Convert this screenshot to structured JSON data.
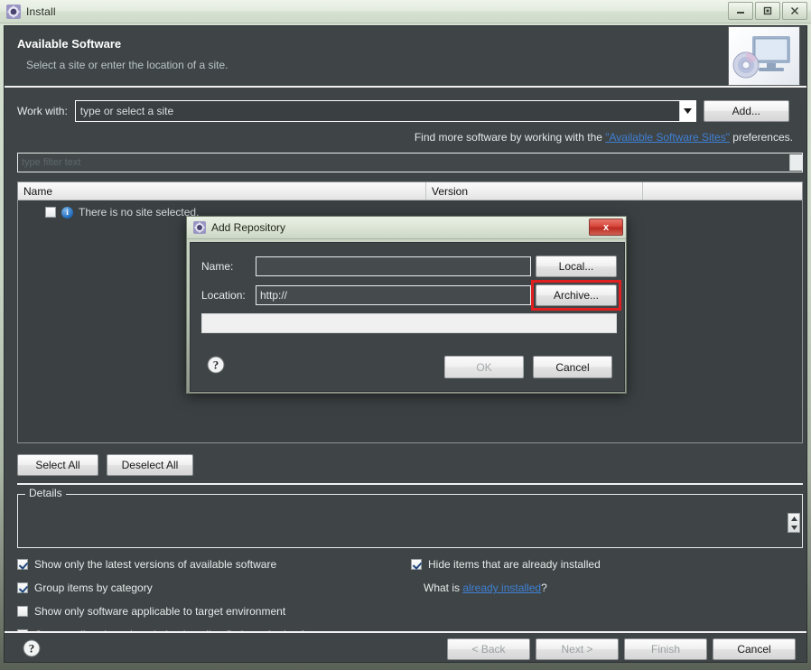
{
  "window": {
    "title": "Install",
    "icon": "eclipse-gear-icon",
    "controls": {
      "minimize": "minimize-icon",
      "maximize": "maximize-icon",
      "close": "close-icon"
    }
  },
  "header": {
    "title": "Available Software",
    "subtitle": "Select a site or enter the location of a site.",
    "banner_icon": "monitor-with-disc-icon"
  },
  "work_with": {
    "label": "Work with:",
    "placeholder": "type or select a site",
    "value": "",
    "dropdown_icon": "chevron-down-icon",
    "add_button": "Add..."
  },
  "find_more": {
    "prefix": "Find more software by working with the ",
    "link": "\"Available Software Sites\"",
    "suffix": " preferences."
  },
  "filter": {
    "placeholder": "type filter text",
    "value": ""
  },
  "table": {
    "columns": [
      "Name",
      "Version",
      ""
    ],
    "empty_message": "There is no site selected.",
    "empty_icon": "info-icon"
  },
  "selection_buttons": {
    "select_all": "Select All",
    "deselect_all": "Deselect All"
  },
  "details": {
    "legend": "Details",
    "content": "",
    "scroll_up_icon": "triangle-up-icon",
    "scroll_down_icon": "triangle-down-icon"
  },
  "options": [
    {
      "label": "Show only the latest versions of available software",
      "checked": true
    },
    {
      "label": "Group items by category",
      "checked": true
    },
    {
      "label": "Show only software applicable to target environment",
      "checked": false
    },
    {
      "label": "Contact all update sites during install to find required software",
      "checked": true
    },
    {
      "label": "Hide items that are already installed",
      "checked": true
    }
  ],
  "what_is": {
    "prefix": "What is ",
    "link": "already installed",
    "suffix": "?"
  },
  "footer": {
    "help_icon": "help-question-icon",
    "buttons": [
      {
        "label": "< Back",
        "enabled": false
      },
      {
        "label": "Next >",
        "enabled": false
      },
      {
        "label": "Finish",
        "enabled": false
      },
      {
        "label": "Cancel",
        "enabled": true
      }
    ]
  },
  "dialog": {
    "title": "Add Repository",
    "icon": "eclipse-gear-icon",
    "close_label": "x",
    "name_label": "Name:",
    "name_value": "",
    "location_label": "Location:",
    "location_value": "http://",
    "local_button": "Local...",
    "archive_button": "Archive...",
    "message": "",
    "help_icon": "help-question-icon",
    "ok_button": "OK",
    "cancel_button": "Cancel",
    "highlight_target": "archive-button",
    "highlight_color": "#e02020"
  }
}
